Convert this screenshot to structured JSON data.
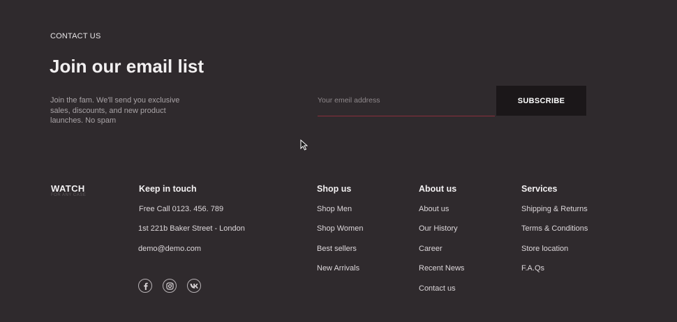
{
  "newsletter": {
    "eyebrow": "CONTACT US",
    "title": "Join our email list",
    "description": "Join the fam. We'll send you exclusive sales, discounts, and new product launches. No spam",
    "email_placeholder": "Your emeil address",
    "subscribe_label": "SUBSCRIBE"
  },
  "logo": {
    "name": "WATCH",
    "tagline": "FOR ANY CASE"
  },
  "columns": {
    "keep_in_touch": {
      "title": "Keep in touch",
      "items": [
        "Free Call 0123. 456. 789",
        "1st 221b Baker Street - London",
        "demo@demo.com"
      ]
    },
    "shop_us": {
      "title": "Shop us",
      "items": [
        "Shop Men",
        "Shop Women",
        "Best sellers",
        "New Arrivals"
      ]
    },
    "about_us": {
      "title": "About us",
      "items": [
        "About us",
        "Our History",
        "Career",
        "Recent News",
        "Contact us"
      ]
    },
    "services": {
      "title": "Services",
      "items": [
        "Shipping & Returns",
        "Terms & Conditions",
        "Store location",
        "F.A.Qs"
      ]
    }
  },
  "social": [
    "facebook-icon",
    "instagram-icon",
    "vk-icon"
  ],
  "colors": {
    "background": "#2f2a2d",
    "button": "#1b1719",
    "input_underline": "#8b2f3c"
  }
}
